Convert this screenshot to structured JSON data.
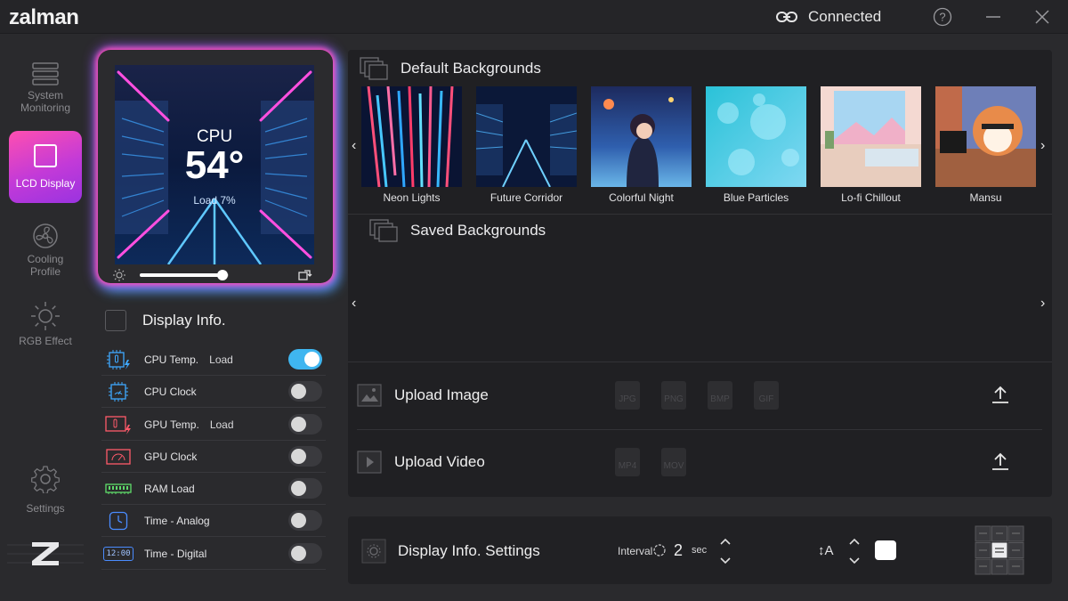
{
  "app": {
    "logo": "zalman",
    "status": "Connected"
  },
  "sidebar": {
    "items": [
      {
        "label_line1": "System",
        "label_line2": "Monitoring"
      },
      {
        "label_line1": "LCD Display"
      },
      {
        "label_line1": "Cooling",
        "label_line2": "Profile"
      },
      {
        "label_line1": "RGB Effect"
      },
      {
        "label_line1": "Settings"
      }
    ]
  },
  "preview": {
    "title": "CPU",
    "value": "54°",
    "sub": "Load 7%",
    "brightness": 0.93
  },
  "display_info": {
    "title": "Display Info.",
    "items": [
      {
        "label": "CPU Temp.",
        "sub": "Load",
        "on": true
      },
      {
        "label": "CPU Clock",
        "sub": "",
        "on": false
      },
      {
        "label": "GPU Temp.",
        "sub": "Load",
        "on": false
      },
      {
        "label": "GPU Clock",
        "sub": "",
        "on": false
      },
      {
        "label": "RAM Load",
        "sub": "",
        "on": false
      },
      {
        "label": "Time - Analog",
        "sub": "",
        "on": false
      },
      {
        "label": "Time - Digital",
        "sub": "",
        "on": false
      }
    ],
    "digital_icon_text": "12:00"
  },
  "default_backgrounds": {
    "title": "Default Backgrounds",
    "items": [
      "Neon Lights",
      "Future Corridor",
      "Colorful Night",
      "Blue Particles",
      "Lo-fi Chillout",
      "Mansu"
    ]
  },
  "saved_backgrounds": {
    "title": "Saved Backgrounds"
  },
  "upload_image": {
    "title": "Upload Image",
    "formats": [
      "JPG",
      "PNG",
      "BMP",
      "GIF"
    ]
  },
  "upload_video": {
    "title": "Upload Video",
    "formats": [
      "MP4",
      "MOV"
    ]
  },
  "settings": {
    "title": "Display Info. Settings",
    "interval_label": "Interval",
    "interval_value": "2",
    "interval_unit": "sec",
    "font_icon_text": "↕A"
  },
  "colors": {
    "accent": "#3fb6f0",
    "lcd_gradient_start": "#ff4fb0",
    "lcd_gradient_end": "#9a33e0"
  }
}
